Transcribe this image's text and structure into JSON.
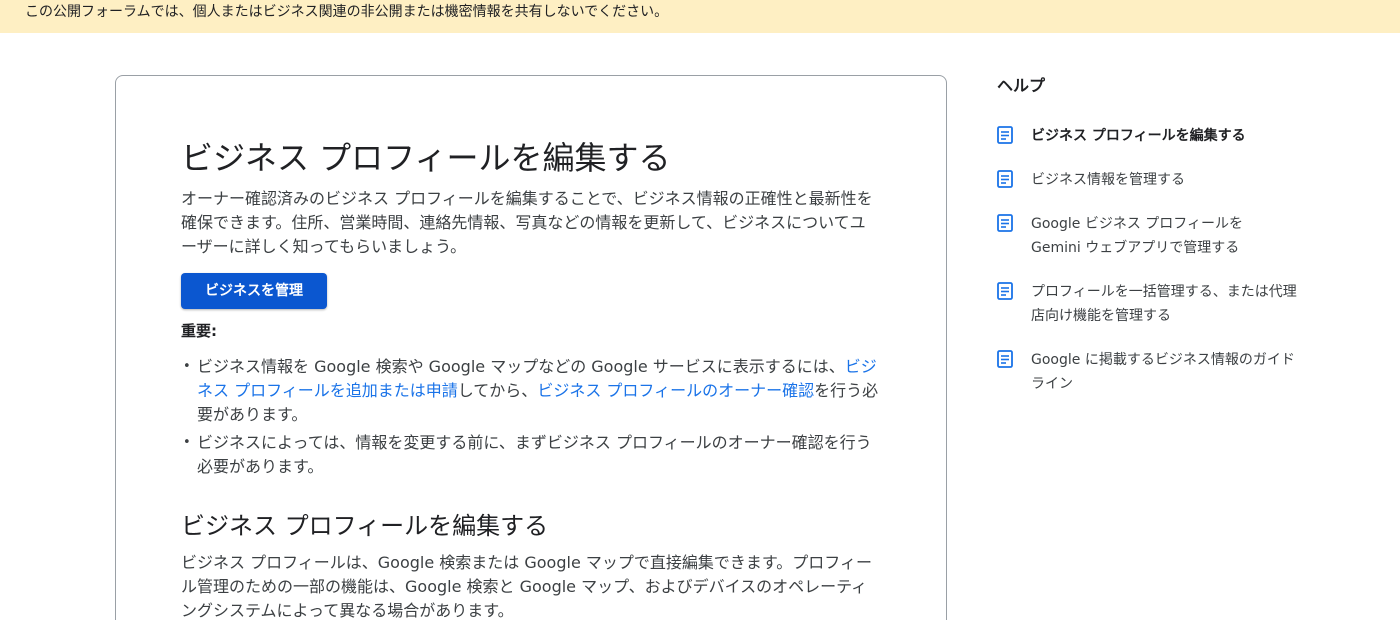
{
  "banner": {
    "text": "この公開フォーラムでは、個人またはビジネス関連の非公開または機密情報を共有しないでください。"
  },
  "article": {
    "title": "ビジネス プロフィールを編集する",
    "intro": "オーナー確認済みのビジネス プロフィールを編集することで、ビジネス情報の正確性と最新性を確保できます。住所、営業時間、連絡先情報、写真などの情報を更新して、ビジネスについてユーザーに詳しく知ってもらいましょう。",
    "manage_button": "ビジネスを管理",
    "important_label": "重要:",
    "bullet1": {
      "before": "ビジネス情報を Google 検索や Google マップなどの Google サービスに表示するには、",
      "link1": "ビジネス プロフィールを追加または申請",
      "middle": "してから、",
      "link2": "ビジネス プロフィールのオーナー確認",
      "after": "を行う必要があります。"
    },
    "bullet2": "ビジネスによっては、情報を変更する前に、まずビジネス プロフィールのオーナー確認を行う必要があります。",
    "section_heading": "ビジネス プロフィールを編集する",
    "section_text": "ビジネス プロフィールは、Google 検索または Google マップで直接編集できます。プロフィール管理のための一部の機能は、Google 検索と Google マップ、およびデバイスのオペレーティングシステムによって異なる場合があります。"
  },
  "sidebar": {
    "title": "ヘルプ",
    "items": [
      {
        "label": "ビジネス プロフィールを編集する",
        "icon": "document-icon"
      },
      {
        "label": "ビジネス情報を管理する",
        "icon": "document-icon"
      },
      {
        "label": "Google ビジネス プロフィールを Gemini ウェブアプリで管理する",
        "icon": "document-icon"
      },
      {
        "label": "プロフィールを一括管理する、または代理店向け機能を管理する",
        "icon": "document-icon"
      },
      {
        "label": "Google に掲載するビジネス情報のガイドライン",
        "icon": "document-icon"
      }
    ]
  },
  "colors": {
    "banner_bg": "#feefc3",
    "primary_button": "#0b57d0",
    "link": "#1a73e8",
    "icon": "#1a73e8"
  }
}
